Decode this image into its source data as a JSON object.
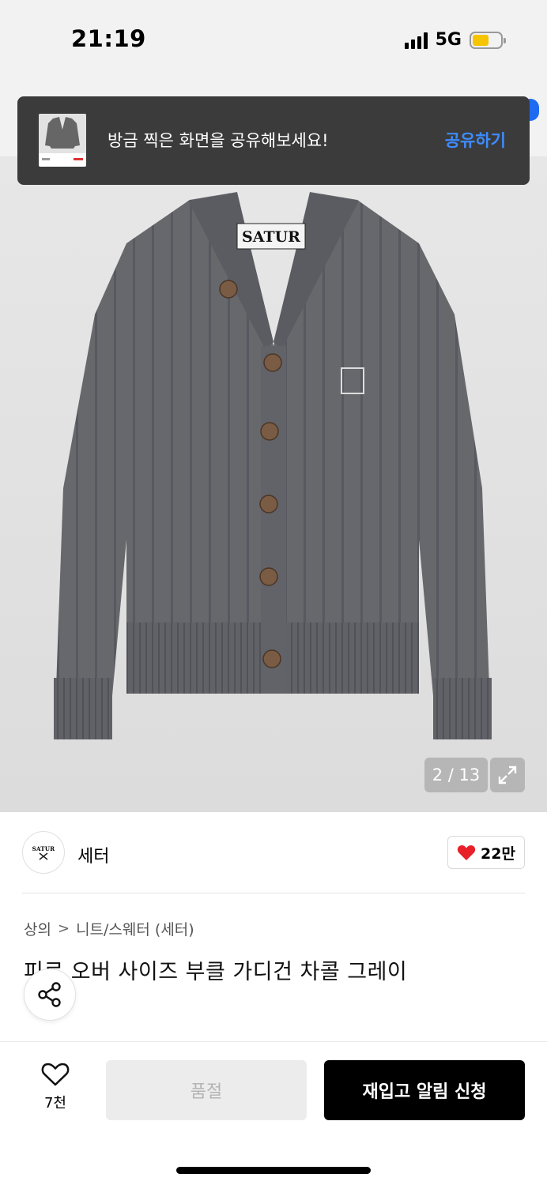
{
  "status_bar": {
    "time": "21:19",
    "network": "5G",
    "battery_color": "#f7c400"
  },
  "toast": {
    "message": "방금 찍은 화면을 공유해보세요!",
    "action_label": "공유하기",
    "action_color": "#3d8cff"
  },
  "product_image": {
    "garment_label": "SATUR",
    "current_index": 2,
    "total": 13,
    "counter_text": "2 / 13"
  },
  "brand": {
    "logo_text": "SATUR",
    "name": "세터",
    "likes": "22만"
  },
  "breadcrumb": {
    "category": "상의",
    "separator": ">",
    "subcategory": "니트/스웨터 (세터)"
  },
  "product": {
    "title": "피르 오버 사이즈 부클 가디건 차콜 그레이"
  },
  "bottom_bar": {
    "wish_count": "7천",
    "soldout_label": "품절",
    "restock_label": "재입고 알림 신청"
  },
  "icons": [
    "heart-icon",
    "share-icon",
    "expand-icon",
    "signal-icon",
    "battery-icon"
  ]
}
